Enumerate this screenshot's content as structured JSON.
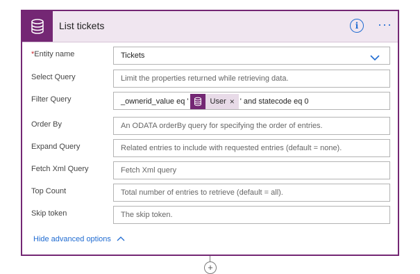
{
  "card": {
    "title": "List tickets",
    "info_icon": "info-icon",
    "more_label": "···",
    "accent_color": "#742774",
    "link_color": "#1f6bd1"
  },
  "fields": {
    "entity_name": {
      "required_mark": "*",
      "label": "Entity name",
      "value": "Tickets"
    },
    "select_query": {
      "label": "Select Query",
      "placeholder": "Limit the properties returned while retrieving data."
    },
    "filter_query": {
      "label": "Filter Query",
      "prefix": "_ownerid_value eq '",
      "token_label": "User",
      "token_close": "×",
      "suffix": "' and statecode eq 0"
    },
    "order_by": {
      "label": "Order By",
      "placeholder": "An ODATA orderBy query for specifying the order of entries."
    },
    "expand_query": {
      "label": "Expand Query",
      "placeholder": "Related entries to include with requested entries (default = none)."
    },
    "fetch_xml_query": {
      "label": "Fetch Xml Query",
      "placeholder": "Fetch Xml query"
    },
    "top_count": {
      "label": "Top Count",
      "placeholder": "Total number of entries to retrieve (default = all)."
    },
    "skip_token": {
      "label": "Skip token",
      "placeholder": "The skip token."
    }
  },
  "advanced": {
    "label": "Hide advanced options"
  },
  "add_step": {
    "label": "+"
  }
}
